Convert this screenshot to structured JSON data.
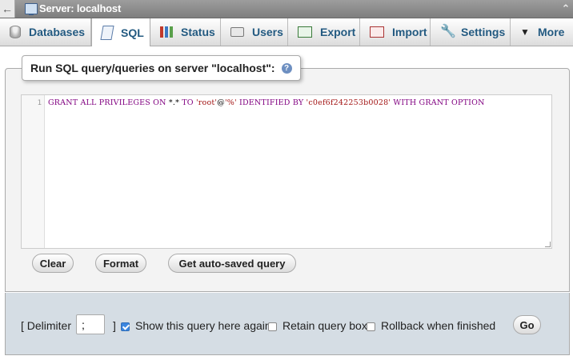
{
  "topbar": {
    "back_glyph": "←",
    "title": "Server: localhost",
    "collapse_glyph": "⌃"
  },
  "tabs": [
    {
      "label": "Databases",
      "icon": "database-icon"
    },
    {
      "label": "SQL",
      "icon": "sql-icon",
      "active": true
    },
    {
      "label": "Status",
      "icon": "status-icon"
    },
    {
      "label": "Users",
      "icon": "users-icon"
    },
    {
      "label": "Export",
      "icon": "export-icon"
    },
    {
      "label": "Import",
      "icon": "import-icon"
    },
    {
      "label": "Settings",
      "icon": "wrench-icon"
    },
    {
      "label": "More",
      "icon": "caret-down-icon"
    }
  ],
  "more_glyph": "▼",
  "settings_glyph": "🔧",
  "query_panel": {
    "legend": "Run SQL query/queries on server \"localhost\":",
    "help_glyph": "?",
    "line_number": "1",
    "code": {
      "kw1": "GRANT ALL PRIVILEGES ON ",
      "op1": "*.*",
      "kw2": " TO ",
      "user": "'root'",
      "op2": "@",
      "host": "'%'",
      "kw3": " IDENTIFIED BY ",
      "pass": "'c0ef6f242253b0028'",
      "kw4": " WITH GRANT OPTION"
    },
    "buttons": {
      "clear": "Clear",
      "format": "Format",
      "autosaved": "Get auto-saved query"
    }
  },
  "options": {
    "delimiter_open": "[ Delimiter",
    "delimiter_value": ";",
    "delimiter_close": "]",
    "show_query": "Show this query here again",
    "show_query_checked": true,
    "retain_box": "Retain query box",
    "retain_box_checked": false,
    "rollback": "Rollback when finished",
    "rollback_checked": false,
    "go": "Go"
  },
  "colors": {
    "link": "#235a81",
    "panel_bg": "#f3f3f3",
    "options_bg": "#d5dde4",
    "checkbox_checked": "#3b86e0"
  }
}
